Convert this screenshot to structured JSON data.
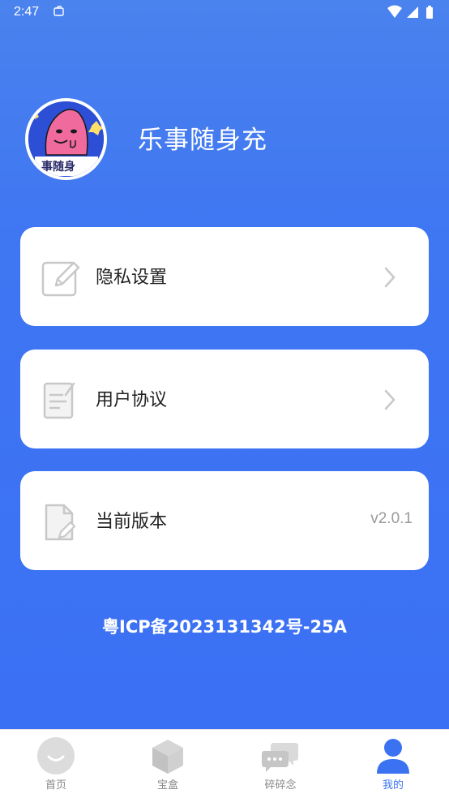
{
  "status_bar": {
    "time": "2:47"
  },
  "profile": {
    "app_name": "乐事随身充",
    "avatar_text": "事随身"
  },
  "menu": [
    {
      "label": "隐私设置",
      "icon": "edit-icon",
      "has_chevron": true
    },
    {
      "label": "用户协议",
      "icon": "document-icon",
      "has_chevron": true
    },
    {
      "label": "当前版本",
      "icon": "file-edit-icon",
      "value": "v2.0.1"
    }
  ],
  "footer": {
    "icp": "粤ICP备2023131342号-25A"
  },
  "bottom_nav": [
    {
      "label": "首页",
      "icon": "home-face-icon",
      "active": false
    },
    {
      "label": "宝盒",
      "icon": "box-icon",
      "active": false
    },
    {
      "label": "碎碎念",
      "icon": "chat-bubbles-icon",
      "active": false
    },
    {
      "label": "我的",
      "icon": "user-icon",
      "active": true
    }
  ],
  "colors": {
    "background": "#3f76f2",
    "accent": "#3b72f2",
    "inactive": "#888888"
  }
}
